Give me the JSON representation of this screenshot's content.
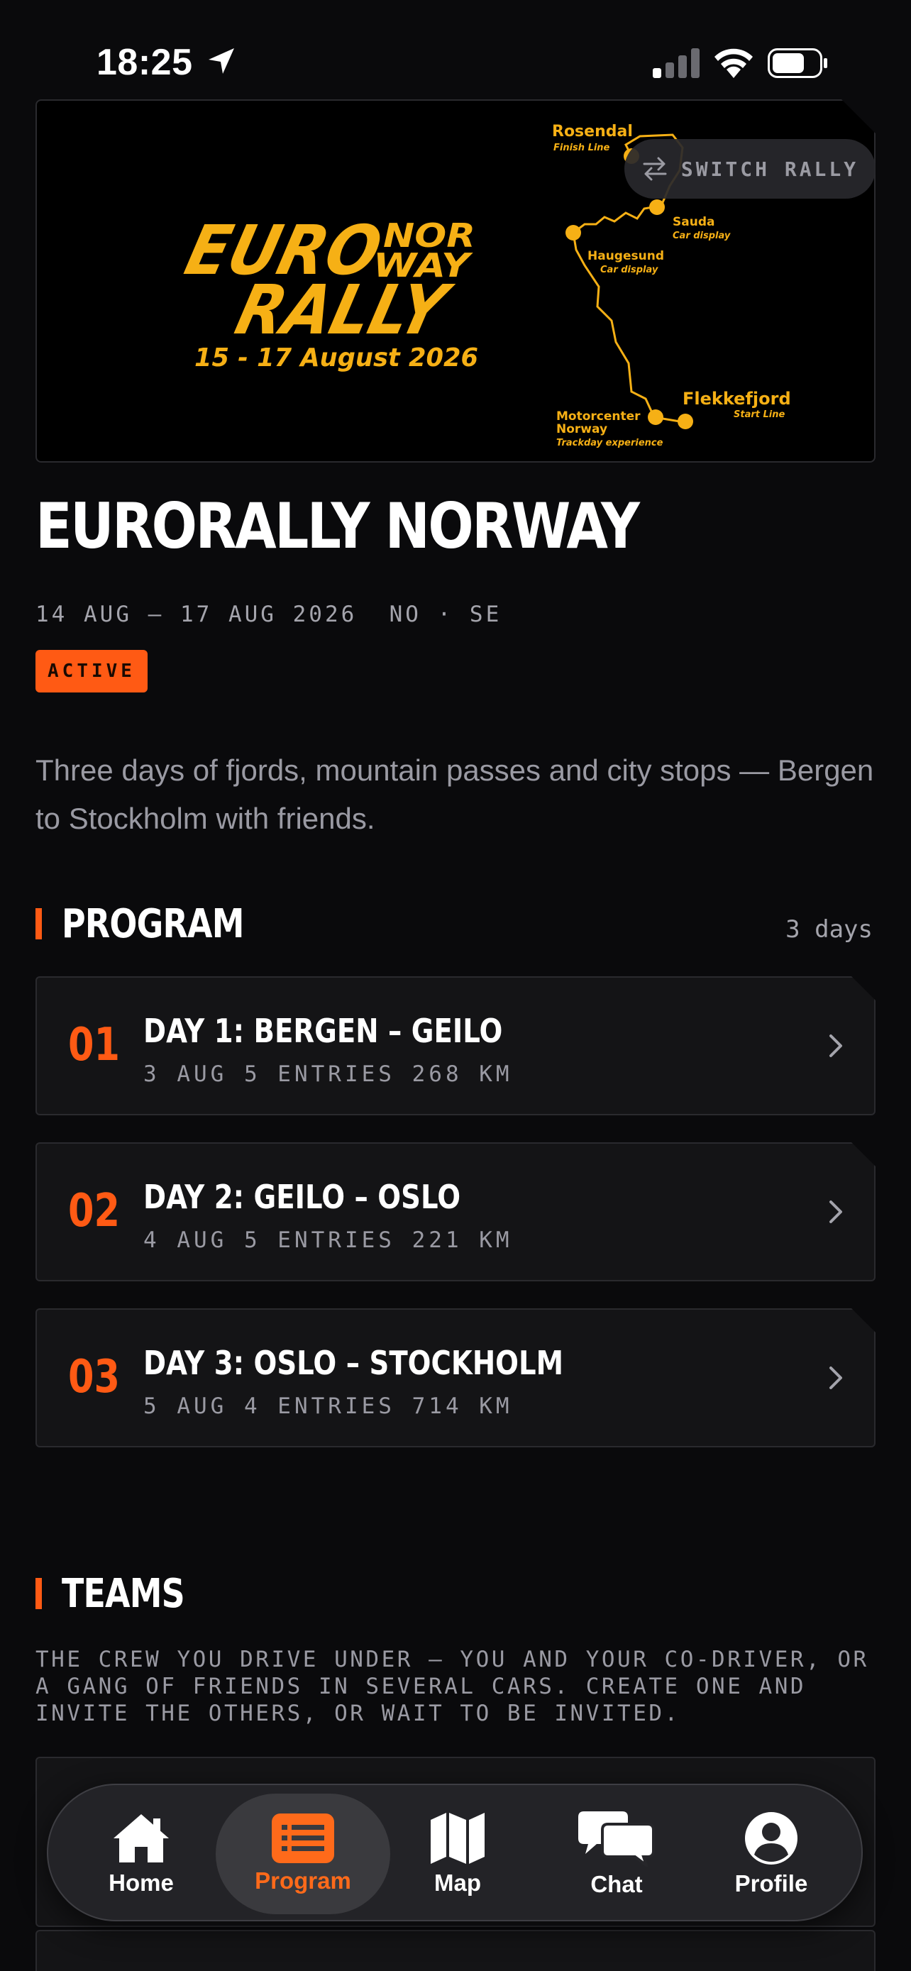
{
  "status_bar": {
    "time": "18:25"
  },
  "hero": {
    "logo": {
      "line1": "EURO",
      "line1b": "NOR",
      "line1c": "WAY",
      "line2": "RALLY",
      "dates": "15 - 17 August 2026"
    },
    "map": {
      "stops": [
        {
          "name": "Rosendal",
          "sub": "Finish Line"
        },
        {
          "name": "Sauda",
          "sub": "Car display"
        },
        {
          "name": "Haugesund",
          "sub": "Car display"
        },
        {
          "name": "Flekkefjord",
          "sub": "Start Line"
        },
        {
          "name": "Motorcenter",
          "name2": "Norway",
          "sub": "Trackday experience"
        }
      ]
    },
    "switch_label": "SWITCH RALLY"
  },
  "rally": {
    "title": "EURORALLY NORWAY",
    "meta": "14 AUG — 17 AUG 2026  NO · SE",
    "status": "ACTIVE",
    "description": "Three days of fjords, mountain passes and city stops — Bergen to Stockholm with friends."
  },
  "program": {
    "heading": "PROGRAM",
    "count": "3 days",
    "days": [
      {
        "num": "01",
        "title": "DAY 1: BERGEN – GEILO",
        "meta": "3 AUG 5 ENTRIES 268 KM"
      },
      {
        "num": "02",
        "title": "DAY 2: GEILO – OSLO",
        "meta": "4 AUG 5 ENTRIES 221 KM"
      },
      {
        "num": "03",
        "title": "DAY 3: OSLO – STOCKHOLM",
        "meta": "5 AUG 4 ENTRIES 714 KM"
      }
    ]
  },
  "teams": {
    "heading": "TEAMS",
    "description": "THE CREW YOU DRIVE UNDER — YOU AND YOUR CO-DRIVER, OR A GANG OF FRIENDS IN SEVERAL CARS. CREATE ONE AND INVITE THE OTHERS, OR WAIT TO BE INVITED."
  },
  "tab_bar": {
    "tabs": [
      {
        "label": "Home",
        "icon": "home-icon"
      },
      {
        "label": "Program",
        "icon": "list-icon",
        "active": true
      },
      {
        "label": "Map",
        "icon": "map-icon"
      },
      {
        "label": "Chat",
        "icon": "chat-icon"
      },
      {
        "label": "Profile",
        "icon": "person-icon"
      }
    ]
  },
  "colors": {
    "accent": "#ff5a14",
    "logo_gold": "#f6b015",
    "background": "#0a0a0c",
    "card": "#141416"
  }
}
